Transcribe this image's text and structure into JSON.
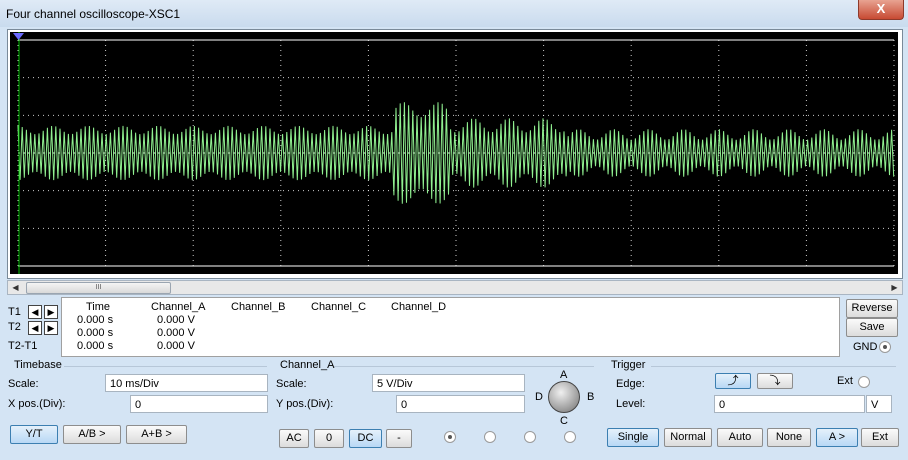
{
  "window": {
    "title": "Four channel oscilloscope-XSC1",
    "close_label": "X"
  },
  "colors": {
    "trace": "#90f090",
    "screen_bg": "#000000",
    "grid": "#ffffff",
    "cursor": "#00c000"
  },
  "waveform": {
    "segments": [
      {
        "from_div": 0.0,
        "to_div": 4.27,
        "amplitude_div": 0.72,
        "low_amp_div": 0.5
      },
      {
        "from_div": 4.27,
        "to_div": 4.93,
        "amplitude_div": 1.35,
        "low_amp_div": 0.95
      },
      {
        "from_div": 4.93,
        "to_div": 6.27,
        "amplitude_div": 0.92,
        "low_amp_div": 0.55
      },
      {
        "from_div": 6.27,
        "to_div": 10.0,
        "amplitude_div": 0.63,
        "low_amp_div": 0.35
      }
    ]
  },
  "scrollbar": {
    "thumb_label": "III"
  },
  "cursors": {
    "t1": "T1",
    "t2": "T2",
    "t2t1": "T2-T1",
    "arrow_left": "◀",
    "arrow_right": "▶"
  },
  "readout": {
    "headers": [
      "Time",
      "Channel_A",
      "Channel_B",
      "Channel_C",
      "Channel_D"
    ],
    "rows": [
      {
        "time": "0.000 s",
        "channel_a": "0.000 V"
      },
      {
        "time": "0.000 s",
        "channel_a": "0.000 V"
      },
      {
        "time": "0.000 s",
        "channel_a": "0.000 V"
      }
    ]
  },
  "side_buttons": {
    "reverse": "Reverse",
    "save": "Save",
    "gnd": "GND"
  },
  "timebase": {
    "group_label": "Timebase",
    "scale_label": "Scale:",
    "scale_value": "10 ms/Div",
    "xpos_label": "X pos.(Div):",
    "xpos_value": "0",
    "buttons": [
      "Y/T",
      "A/B >",
      "A+B >"
    ]
  },
  "channel": {
    "group_label": "Channel_A",
    "scale_label": "Scale:",
    "scale_value": "5  V/Div",
    "ypos_label": "Y pos.(Div):",
    "ypos_value": "0",
    "buttons": [
      "AC",
      "0",
      "DC",
      "-"
    ],
    "knob_labels": {
      "a": "A",
      "b": "B",
      "c": "C",
      "d": "D"
    }
  },
  "trigger": {
    "group_label": "Trigger",
    "edge_label": "Edge:",
    "edge_rise": "⤴",
    "edge_fall": "⤵",
    "ext_label": "Ext",
    "level_label": "Level:",
    "level_value": "0",
    "level_unit": "V",
    "buttons": [
      "Single",
      "Normal",
      "Auto",
      "None",
      "A >",
      "Ext"
    ]
  }
}
